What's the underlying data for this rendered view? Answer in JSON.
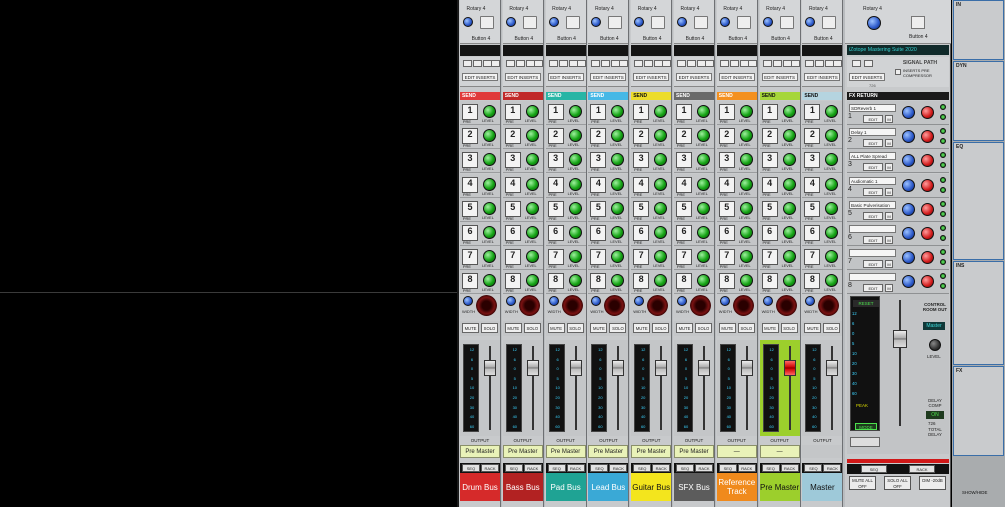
{
  "channels": [
    {
      "name": "Drum Bus",
      "color": "#d62a2a",
      "text": "#fff",
      "send_color": "#e03a3a"
    },
    {
      "name": "Bass Bus",
      "color": "#b22222",
      "text": "#fff",
      "send_color": "#c02828"
    },
    {
      "name": "Pad Bus",
      "color": "#1fa394",
      "text": "#fff",
      "send_color": "#27b5a5"
    },
    {
      "name": "Lead Bus",
      "color": "#3aa9d6",
      "text": "#fff",
      "send_color": "#46b8e6"
    },
    {
      "name": "Guitar Bus",
      "color": "#f3e51d",
      "text": "#111",
      "send_color": "#ecdc2a"
    },
    {
      "name": "SFX Bus",
      "color": "#5c5c5c",
      "text": "#fff",
      "send_color": "#6a6a6a"
    },
    {
      "name": "Reference Track",
      "color": "#f08a1c",
      "text": "#fff",
      "send_color": "#f4901f"
    },
    {
      "name": "Pre Master",
      "color": "#9ccf2c",
      "text": "#111",
      "send_color": "#a6d63a"
    },
    {
      "name": "Master",
      "color": "#9ec9d9",
      "text": "#111",
      "send_color": "#b5d4e0"
    }
  ],
  "strip_labels": {
    "rotary": "Rotary 4",
    "button": "Button 4",
    "edit_inserts": "EDIT INSERTS",
    "send": "SEND",
    "pre": "PRE",
    "level": "LEVEL",
    "width": "WIDTH",
    "l": "L",
    "r": "R",
    "mute": "MUTE",
    "solo": "SOLO",
    "output": "OUTPUT",
    "seq": "SEQ",
    "rack": "RACK"
  },
  "send_numbers": [
    "1",
    "2",
    "3",
    "4",
    "5",
    "6",
    "7",
    "8"
  ],
  "outputs": [
    "Pre Master",
    "Pre Master",
    "Pre Master",
    "Pre Master",
    "Pre Master",
    "Pre Master",
    "—",
    "—",
    ""
  ],
  "master": {
    "rotary": "Rotary 4",
    "button": "Button 4",
    "plugin": "iZotope Mastering Suite 2020",
    "signal_path": "SIGNAL PATH",
    "inserts_pre": "INSERTS PRE COMPRESSOR",
    "edit_inserts": "EDIT INSERTS",
    "ins_value": "726",
    "fx_return": "FX RETURN",
    "fx": [
      {
        "n": "1",
        "name": "SDReverb 1"
      },
      {
        "n": "2",
        "name": "Delay 1"
      },
      {
        "n": "3",
        "name": "ALL Plate Spread"
      },
      {
        "n": "4",
        "name": "Audiomatic 1"
      },
      {
        "n": "5",
        "name": "Basic Pulverisation"
      },
      {
        "n": "6",
        "name": ""
      },
      {
        "n": "7",
        "name": ""
      },
      {
        "n": "8",
        "name": ""
      }
    ],
    "edit": "EDIT",
    "m": "M",
    "level": "LEVEL",
    "pan": "PAN",
    "reset": "RESET",
    "control_room": "CONTROL ROOM OUT",
    "master_label": "Master",
    "delay_comp": "DELAY COMP",
    "on": "ON",
    "delay_value": "726",
    "total_delay": "TOTAL DELAY",
    "peak": "PEAK",
    "vu": "VU",
    "mode": "MODE",
    "seq": "SEQ",
    "rack": "RACK",
    "mute_all": "MUTE ALL OFF",
    "solo_all": "SOLO ALL OFF",
    "dim": "DIM -20dB",
    "meter_scale": [
      "12",
      "6",
      "0",
      "5",
      "10",
      "20",
      "30",
      "40",
      "60"
    ]
  },
  "meter_scale": [
    "12",
    "6",
    "0",
    "5",
    "10",
    "20",
    "30",
    "40",
    "60"
  ],
  "right_panel": {
    "in": "IN",
    "dyn": "DYN",
    "eq": "EQ",
    "ins": "INS",
    "fx": "FX",
    "show_hide": "SHOW/HIDE"
  },
  "colors": {
    "master_accent": "#d01818",
    "fx_header": "#1a1a1a"
  }
}
